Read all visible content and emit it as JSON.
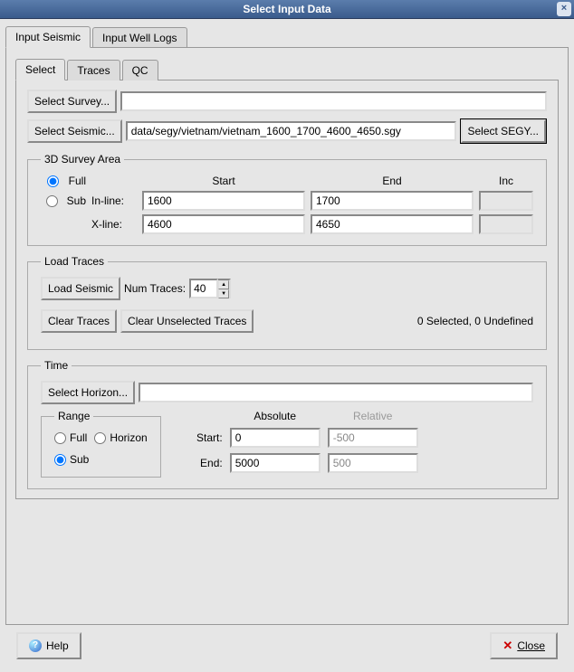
{
  "window": {
    "title": "Select Input Data"
  },
  "topTabs": {
    "seismic": "Input Seismic",
    "wellLogs": "Input Well Logs"
  },
  "subTabs": {
    "select": "Select",
    "traces": "Traces",
    "qc": "QC"
  },
  "selectSurvey": {
    "button": "Select Survey...",
    "value": ""
  },
  "selectSeismic": {
    "button": "Select Seismic...",
    "value": "data/segy/vietnam/vietnam_1600_1700_4600_4650.sgy",
    "segyButton": "Select SEGY..."
  },
  "survey3d": {
    "legend": "3D Survey Area",
    "full": "Full",
    "sub": "Sub",
    "startHdr": "Start",
    "endHdr": "End",
    "incHdr": "Inc",
    "inlineLbl": "In-line:",
    "xlineLbl": "X-line:",
    "inlineStart": "1600",
    "inlineEnd": "1700",
    "xlineStart": "4600",
    "xlineEnd": "4650"
  },
  "loadTraces": {
    "legend": "Load Traces",
    "loadBtn": "Load Seismic",
    "numTracesLbl": "Num Traces:",
    "numTraces": "40",
    "clearBtn": "Clear Traces",
    "clearUnselBtn": "Clear Unselected Traces",
    "status": "0 Selected, 0 Undefined"
  },
  "time": {
    "legend": "Time",
    "selectHorizon": "Select Horizon...",
    "horizonValue": "",
    "rangeLegend": "Range",
    "full": "Full",
    "horizon": "Horizon",
    "sub": "Sub",
    "absHdr": "Absolute",
    "relHdr": "Relative",
    "startLbl": "Start:",
    "endLbl": "End:",
    "startAbs": "0",
    "startRel": "-500",
    "endAbs": "5000",
    "endRel": "500"
  },
  "footer": {
    "help": "Help",
    "close": "Close"
  }
}
